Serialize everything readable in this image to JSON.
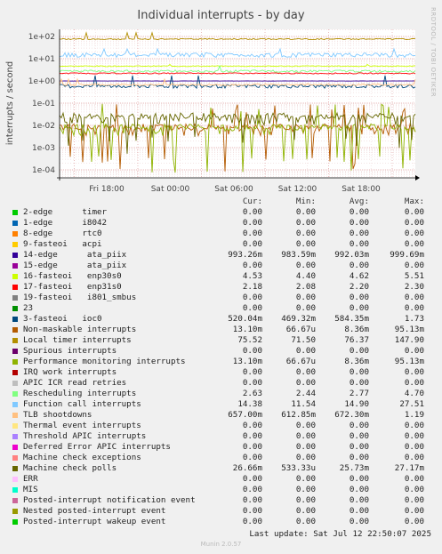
{
  "chart_data": {
    "type": "line",
    "title": "Individual interrupts - by day",
    "ylabel": "interrupts / second",
    "yscale": "log",
    "ylim": [
      5e-05,
      200
    ],
    "y_ticks": [
      "1e+02",
      "1e+01",
      "1e+00",
      "1e-01",
      "1e-02",
      "1e-03",
      "1e-04"
    ],
    "x_ticks": [
      "Fri 18:00",
      "Sat 00:00",
      "Sat 06:00",
      "Sat 12:00",
      "Sat 18:00"
    ],
    "grid": true,
    "legend_columns": [
      "Cur:",
      "Min:",
      "Avg:",
      "Max:"
    ],
    "series": [
      {
        "name": "2-edge      timer",
        "color": "#00cc00",
        "cur": "0.00",
        "min": "0.00",
        "avg": "0.00",
        "max": "0.00"
      },
      {
        "name": "1-edge      i8042",
        "color": "#0066b3",
        "cur": "0.00",
        "min": "0.00",
        "avg": "0.00",
        "max": "0.00"
      },
      {
        "name": "8-edge      rtc0",
        "color": "#ff8000",
        "cur": "0.00",
        "min": "0.00",
        "avg": "0.00",
        "max": "0.00"
      },
      {
        "name": "9-fasteoi   acpi",
        "color": "#ffcc00",
        "cur": "0.00",
        "min": "0.00",
        "avg": "0.00",
        "max": "0.00"
      },
      {
        "name": "14-edge      ata_piix",
        "color": "#330099",
        "cur": "993.26m",
        "min": "983.59m",
        "avg": "992.03m",
        "max": "999.69m"
      },
      {
        "name": "15-edge      ata_piix",
        "color": "#990099",
        "cur": "0.00",
        "min": "0.00",
        "avg": "0.00",
        "max": "0.00"
      },
      {
        "name": "16-fasteoi   enp30s0",
        "color": "#ccff00",
        "cur": "4.53",
        "min": "4.40",
        "avg": "4.62",
        "max": "5.51"
      },
      {
        "name": "17-fasteoi   enp31s0",
        "color": "#ff0000",
        "cur": "2.18",
        "min": "2.08",
        "avg": "2.20",
        "max": "2.30"
      },
      {
        "name": "19-fasteoi   i801_smbus",
        "color": "#808080",
        "cur": "0.00",
        "min": "0.00",
        "avg": "0.00",
        "max": "0.00"
      },
      {
        "name": "23",
        "color": "#008f00",
        "cur": "0.00",
        "min": "0.00",
        "avg": "0.00",
        "max": "0.00"
      },
      {
        "name": "3-fasteoi   ioc0",
        "color": "#00487d",
        "cur": "520.04m",
        "min": "469.32m",
        "avg": "584.35m",
        "max": "1.73"
      },
      {
        "name": "Non-maskable interrupts",
        "color": "#b35a00",
        "cur": "13.10m",
        "min": "66.67u",
        "avg": "8.36m",
        "max": "95.13m"
      },
      {
        "name": "Local timer interrupts",
        "color": "#b38f00",
        "cur": "75.52",
        "min": "71.50",
        "avg": "76.37",
        "max": "147.90"
      },
      {
        "name": "Spurious interrupts",
        "color": "#6b006b",
        "cur": "0.00",
        "min": "0.00",
        "avg": "0.00",
        "max": "0.00"
      },
      {
        "name": "Performance monitoring interrupts",
        "color": "#8fb300",
        "cur": "13.10m",
        "min": "66.67u",
        "avg": "8.36m",
        "max": "95.13m"
      },
      {
        "name": "IRQ work interrupts",
        "color": "#b30000",
        "cur": "0.00",
        "min": "0.00",
        "avg": "0.00",
        "max": "0.00"
      },
      {
        "name": "APIC ICR read retries",
        "color": "#bebebe",
        "cur": "0.00",
        "min": "0.00",
        "avg": "0.00",
        "max": "0.00"
      },
      {
        "name": "Rescheduling interrupts",
        "color": "#80ff80",
        "cur": "2.63",
        "min": "2.44",
        "avg": "2.77",
        "max": "4.70"
      },
      {
        "name": "Function call interrupts",
        "color": "#80c9ff",
        "cur": "14.38",
        "min": "11.54",
        "avg": "14.90",
        "max": "27.51"
      },
      {
        "name": "TLB shootdowns",
        "color": "#ffc080",
        "cur": "657.00m",
        "min": "612.85m",
        "avg": "672.30m",
        "max": "1.19"
      },
      {
        "name": "Thermal event interrupts",
        "color": "#ffe680",
        "cur": "0.00",
        "min": "0.00",
        "avg": "0.00",
        "max": "0.00"
      },
      {
        "name": "Threshold APIC interrupts",
        "color": "#aa80ff",
        "cur": "0.00",
        "min": "0.00",
        "avg": "0.00",
        "max": "0.00"
      },
      {
        "name": "Deferred Error APIC interrupts",
        "color": "#ee00cc",
        "cur": "0.00",
        "min": "0.00",
        "avg": "0.00",
        "max": "0.00"
      },
      {
        "name": "Machine check exceptions",
        "color": "#ff8080",
        "cur": "0.00",
        "min": "0.00",
        "avg": "0.00",
        "max": "0.00"
      },
      {
        "name": "Machine check polls",
        "color": "#666600",
        "cur": "26.66m",
        "min": "533.33u",
        "avg": "25.73m",
        "max": "27.17m"
      },
      {
        "name": "ERR",
        "color": "#ffbfff",
        "cur": "0.00",
        "min": "0.00",
        "avg": "0.00",
        "max": "0.00"
      },
      {
        "name": "MIS",
        "color": "#00ffcc",
        "cur": "0.00",
        "min": "0.00",
        "avg": "0.00",
        "max": "0.00"
      },
      {
        "name": "Posted-interrupt notification event",
        "color": "#cc6699",
        "cur": "0.00",
        "min": "0.00",
        "avg": "0.00",
        "max": "0.00"
      },
      {
        "name": "Nested posted-interrupt event",
        "color": "#999900",
        "cur": "0.00",
        "min": "0.00",
        "avg": "0.00",
        "max": "0.00"
      },
      {
        "name": "Posted-interrupt wakeup event",
        "color": "#00cc00",
        "cur": "0.00",
        "min": "0.00",
        "avg": "0.00",
        "max": "0.00"
      }
    ]
  },
  "side_label": "RRDTOOL / TOBI OETIKER",
  "last_update": "Last update: Sat Jul 12 22:50:07 2025",
  "munin_version": "Munin 2.0.57"
}
